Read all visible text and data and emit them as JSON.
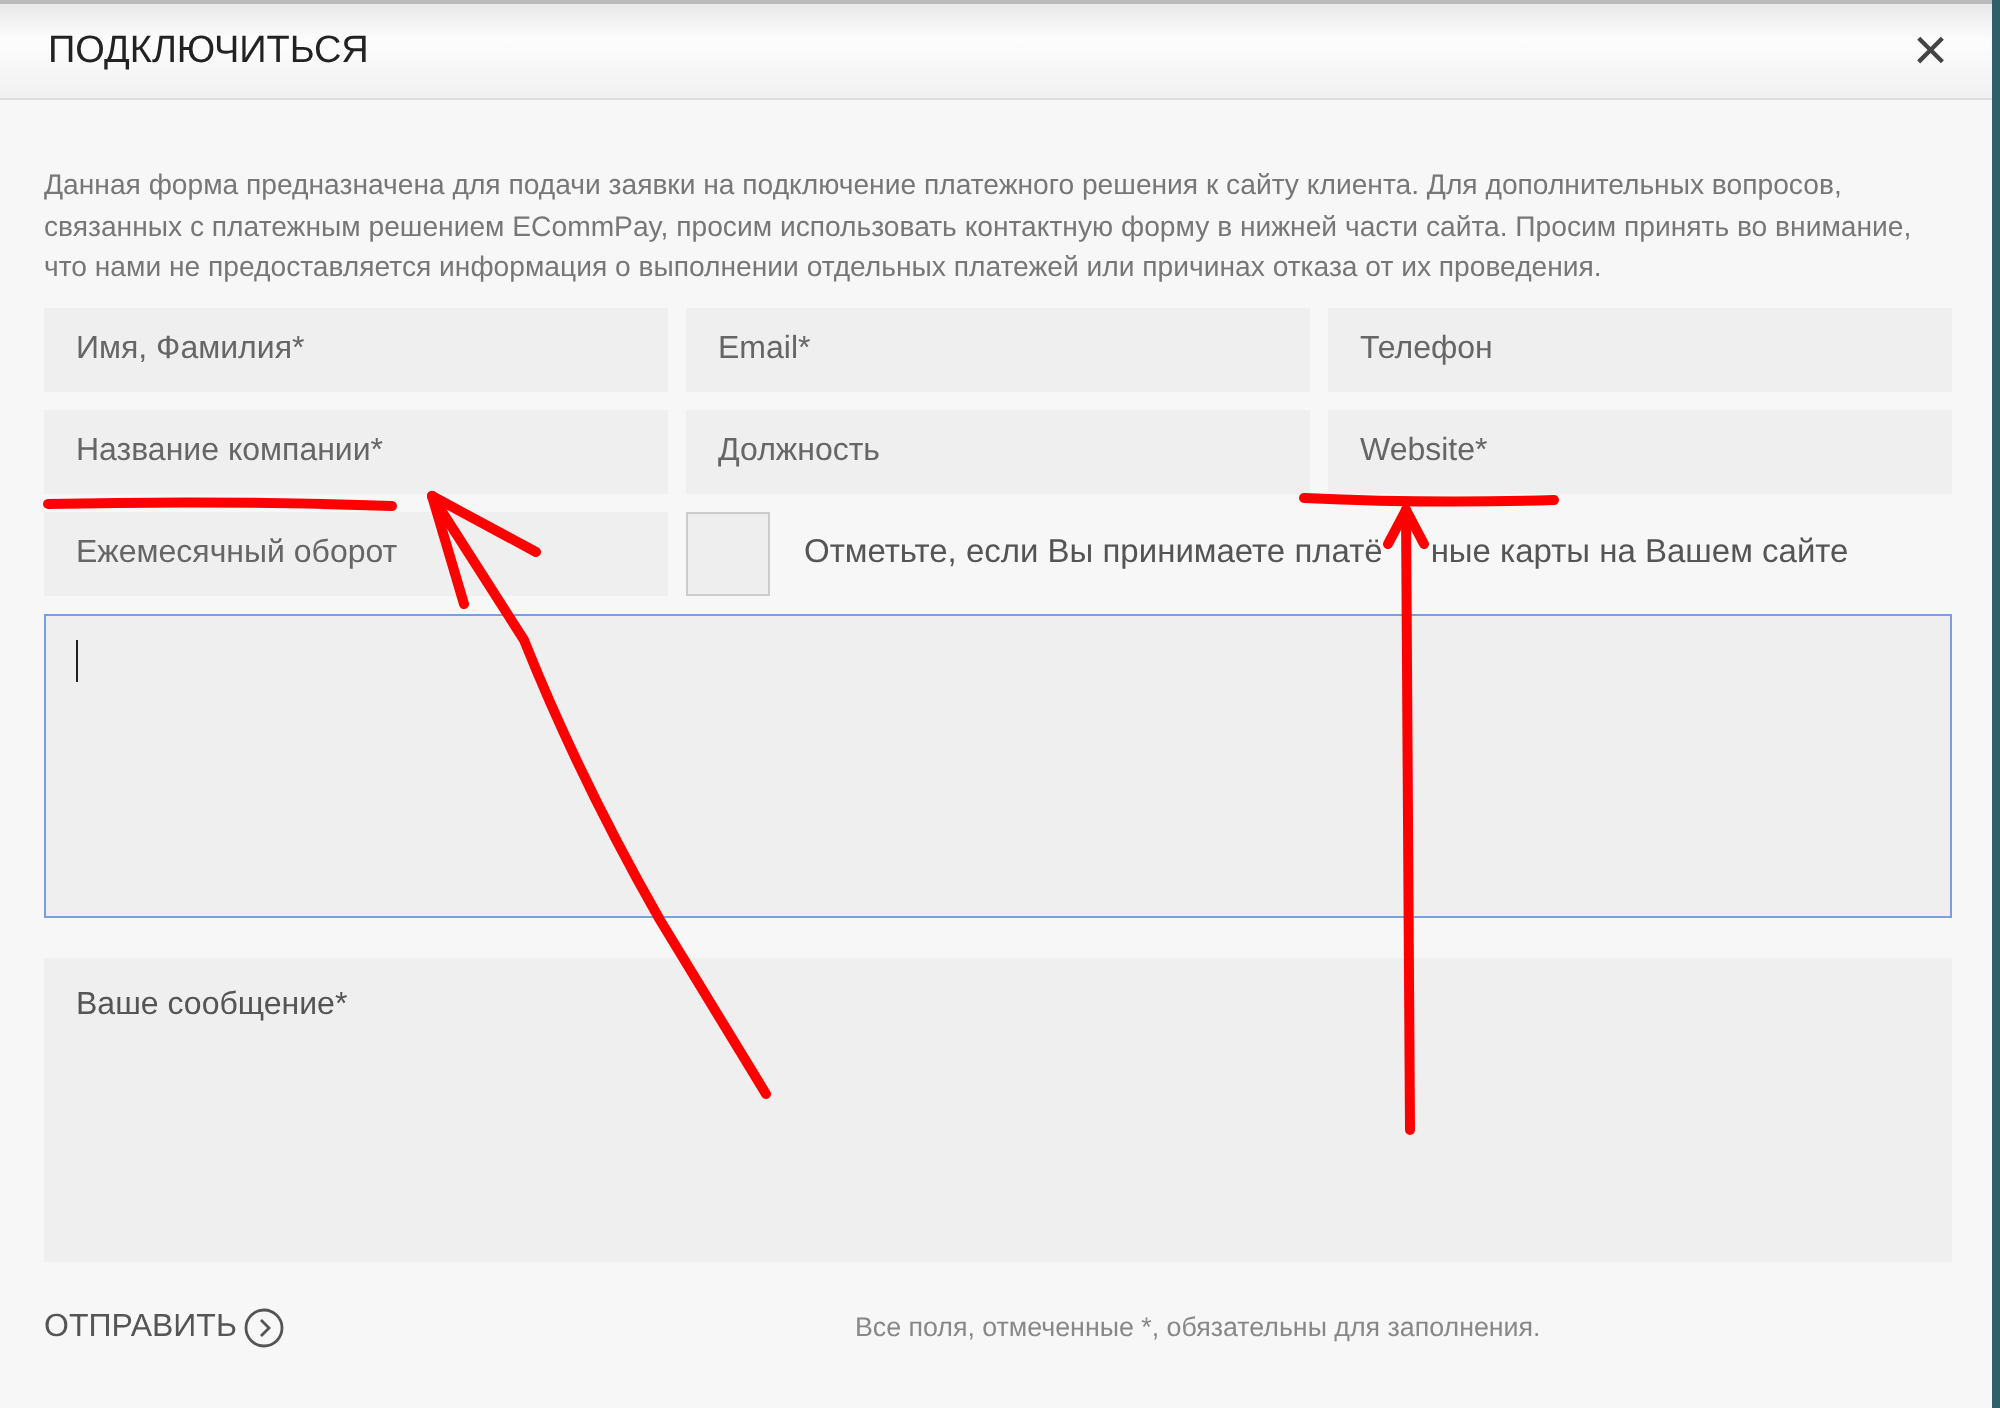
{
  "dialog": {
    "title": "ПОДКЛЮЧИТЬСЯ",
    "close": "×"
  },
  "description": "Данная форма предназначена для подачи заявки на подключение платежного решения к сайту клиента. Для дополнительных вопросов, связанных с платежным решением ECommPay, просим использовать контактную форму в нижней части сайта. Просим принять во внимание, что нами не предоставляется информация о выполнении отдельных платежей или причинах отказа от их проведения.",
  "fields": [
    {
      "kind": "input",
      "placeholder": "Имя, Фамилия*"
    },
    {
      "kind": "input",
      "placeholder": "Email*"
    },
    {
      "kind": "input",
      "placeholder": "Телефон"
    },
    {
      "kind": "input",
      "placeholder": "Название компании*"
    },
    {
      "kind": "input",
      "placeholder": "Должность"
    },
    {
      "kind": "input",
      "placeholder": "Website*"
    },
    {
      "kind": "input",
      "placeholder": "Ежемесячный оборот"
    },
    {
      "kind": "checkbox",
      "label_parts": [
        "Отметьте, если Вы принимаете платё",
        "ные карты на Вашем сайте"
      ],
      "checked": false
    },
    {
      "kind": "textarea",
      "focused": true
    },
    {
      "kind": "textarea",
      "placeholder": "Ваше сообщение*",
      "focused": false
    }
  ],
  "submit": {
    "label": "ОТПРАВИТЬ"
  },
  "note": "Все поля, отмеченные *, обязательны для заполнения."
}
